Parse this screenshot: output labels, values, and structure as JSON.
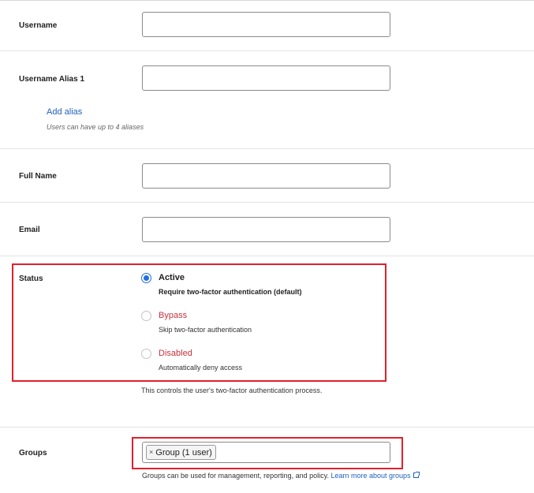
{
  "fields": {
    "username": {
      "label": "Username",
      "value": ""
    },
    "username_alias_1": {
      "label": "Username Alias 1",
      "value": ""
    },
    "add_alias": "Add alias",
    "alias_help": "Users can have up to 4 aliases",
    "full_name": {
      "label": "Full Name",
      "value": ""
    },
    "email": {
      "label": "Email",
      "value": ""
    }
  },
  "status": {
    "label": "Status",
    "options": [
      {
        "label": "Active",
        "description": "Require two-factor authentication (default)",
        "selected": true
      },
      {
        "label": "Bypass",
        "description": "Skip two-factor authentication",
        "selected": false
      },
      {
        "label": "Disabled",
        "description": "Automatically deny access",
        "selected": false
      }
    ],
    "help": "This controls the user's two-factor authentication process."
  },
  "groups": {
    "label": "Groups",
    "chips": [
      {
        "label": "Group (1 user)",
        "remove": "×"
      }
    ],
    "help": "Groups can be used for management, reporting, and policy.",
    "help_link": "Learn more about groups"
  },
  "colors": {
    "accent": "#1f6fe0",
    "link": "#1f5fbf",
    "warning_text": "#c8323c",
    "highlight_border": "#e0202c"
  }
}
